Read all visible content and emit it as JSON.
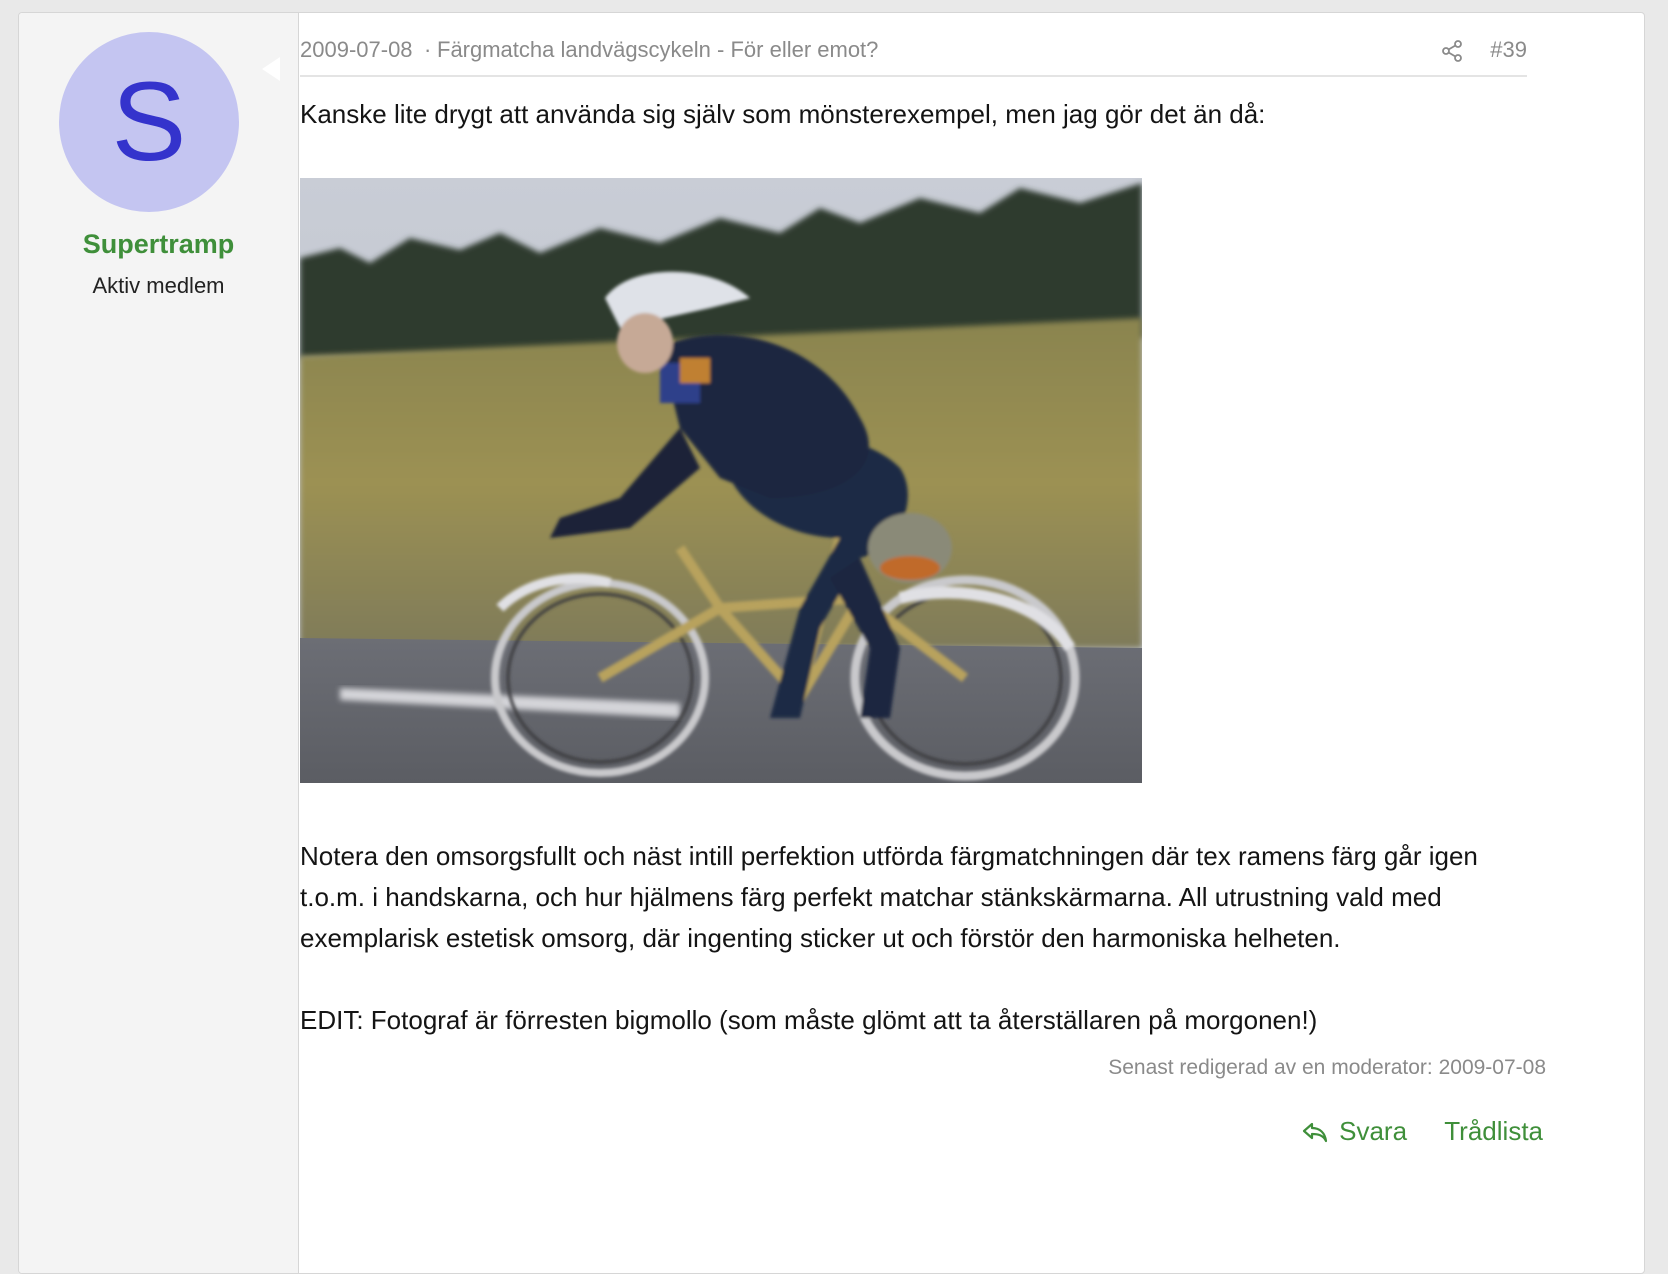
{
  "user": {
    "avatar_letter": "S",
    "name": "Supertramp",
    "title": "Aktiv medlem",
    "avatar_bg": "#c4c5f1",
    "avatar_fg": "#3433cc"
  },
  "post": {
    "date": "2009-07-08",
    "separator": "·",
    "thread_title": "Färgmatcha landvägscykeln - För eller emot?",
    "post_number": "#39",
    "intro": "Kanske lite drygt att använda sig själv som mönsterexempel, men jag gör det än då:",
    "body": "Notera den omsorgsfullt och näst intill perfektion utförda färgmatchningen där tex ramens färg går igen t.o.m. i handskarna, och hur hjälmens färg perfekt matchar stänkskärmarna. All utrustning vald med exemplarisk estetisk omsorg, där ingenting sticker ut och förstör den harmoniska helheten.",
    "edit_note": "EDIT: Fotograf är förresten bigmollo (som måste glömt att ta återställaren på morgonen!)",
    "last_edited": "Senast redigerad av en moderator: 2009-07-08"
  },
  "actions": {
    "reply_label": "Svara",
    "thread_list_label": "Trådlista"
  },
  "icons": {
    "share": "share-icon",
    "reply": "reply-arrow-icon"
  },
  "colors": {
    "accent_green": "#3f8f3a",
    "muted_text": "#8a8a8a"
  }
}
